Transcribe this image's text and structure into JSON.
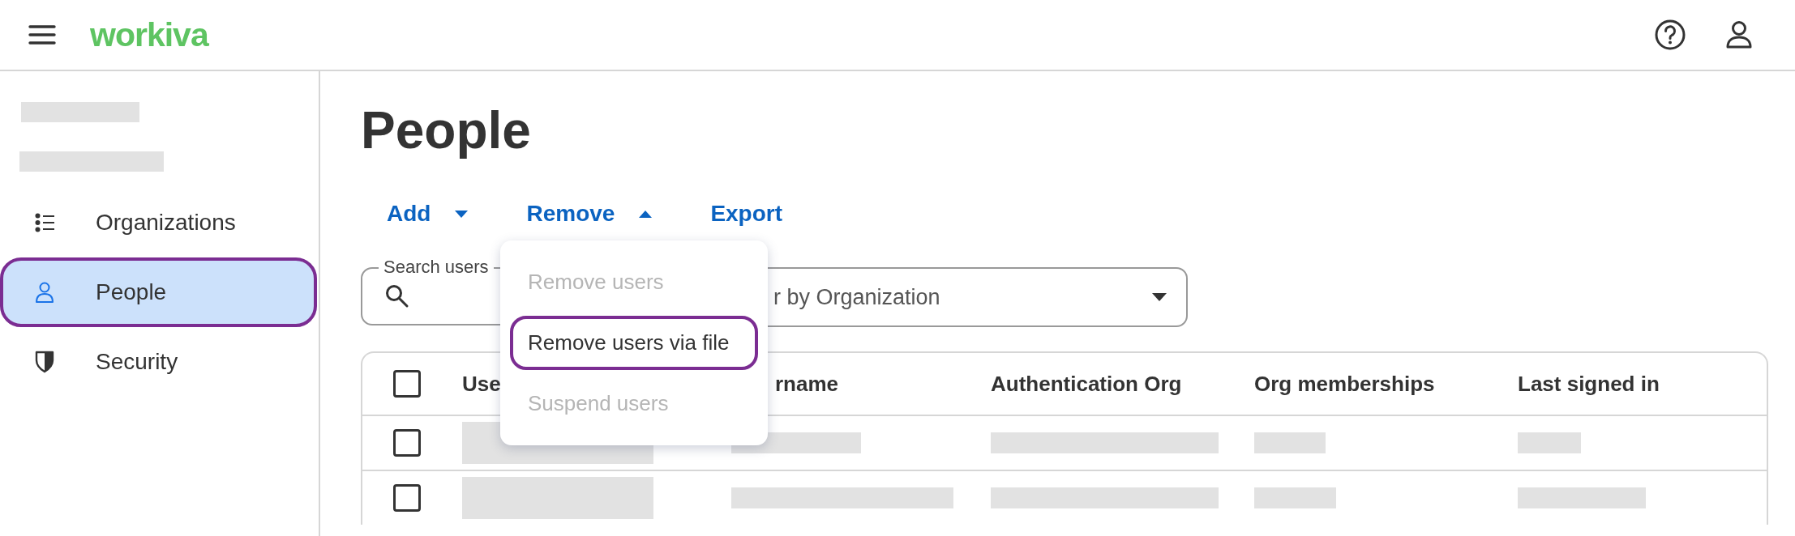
{
  "header": {
    "logo": "workiva"
  },
  "sidebar": {
    "items": [
      {
        "label": "Organizations",
        "selected": false,
        "highlighted": false
      },
      {
        "label": "People",
        "selected": true,
        "highlighted": true
      },
      {
        "label": "Security",
        "selected": false,
        "highlighted": false
      }
    ]
  },
  "page": {
    "title": "People"
  },
  "toolbar": [
    {
      "label": "Add",
      "kind": "dropdown",
      "expanded": false
    },
    {
      "label": "Remove",
      "kind": "dropdown",
      "expanded": true
    },
    {
      "label": "Export",
      "kind": "button"
    }
  ],
  "search": {
    "label": "Search users"
  },
  "filter": {
    "placeholder": "r by Organization"
  },
  "menu": {
    "items": [
      {
        "label": "Remove users",
        "disabled": true,
        "highlighted": false
      },
      {
        "label": "Remove users via file",
        "disabled": false,
        "highlighted": true
      },
      {
        "label": "Suspend users",
        "disabled": true,
        "highlighted": false
      }
    ]
  },
  "table": {
    "select_all": {
      "checked": false
    },
    "columns": [
      "Use",
      "rname",
      "Authentication Org",
      "Org memberships",
      "Last signed in"
    ],
    "rows": [
      {
        "checked": false
      },
      {
        "checked": false
      }
    ]
  }
}
